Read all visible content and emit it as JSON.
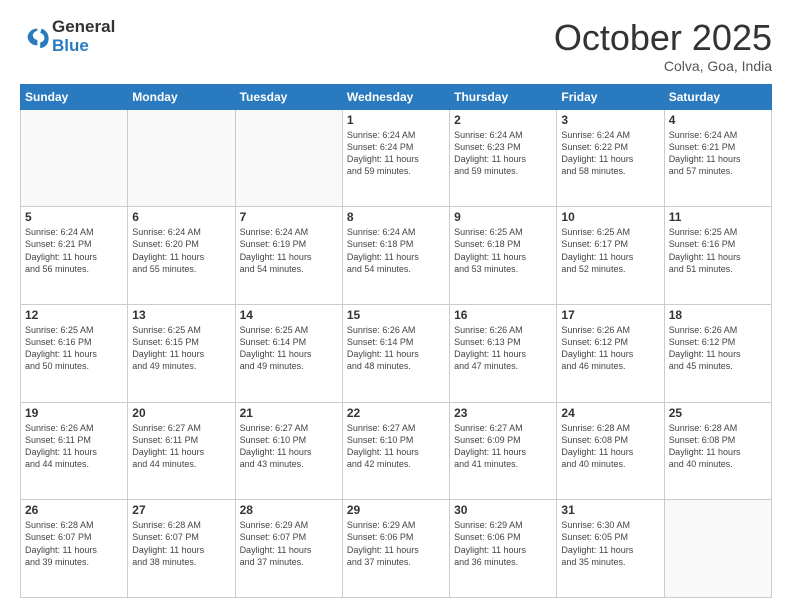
{
  "header": {
    "logo_general": "General",
    "logo_blue": "Blue",
    "month_title": "October 2025",
    "subtitle": "Colva, Goa, India"
  },
  "weekdays": [
    "Sunday",
    "Monday",
    "Tuesday",
    "Wednesday",
    "Thursday",
    "Friday",
    "Saturday"
  ],
  "weeks": [
    [
      {
        "day": "",
        "info": ""
      },
      {
        "day": "",
        "info": ""
      },
      {
        "day": "",
        "info": ""
      },
      {
        "day": "1",
        "info": "Sunrise: 6:24 AM\nSunset: 6:24 PM\nDaylight: 11 hours\nand 59 minutes."
      },
      {
        "day": "2",
        "info": "Sunrise: 6:24 AM\nSunset: 6:23 PM\nDaylight: 11 hours\nand 59 minutes."
      },
      {
        "day": "3",
        "info": "Sunrise: 6:24 AM\nSunset: 6:22 PM\nDaylight: 11 hours\nand 58 minutes."
      },
      {
        "day": "4",
        "info": "Sunrise: 6:24 AM\nSunset: 6:21 PM\nDaylight: 11 hours\nand 57 minutes."
      }
    ],
    [
      {
        "day": "5",
        "info": "Sunrise: 6:24 AM\nSunset: 6:21 PM\nDaylight: 11 hours\nand 56 minutes."
      },
      {
        "day": "6",
        "info": "Sunrise: 6:24 AM\nSunset: 6:20 PM\nDaylight: 11 hours\nand 55 minutes."
      },
      {
        "day": "7",
        "info": "Sunrise: 6:24 AM\nSunset: 6:19 PM\nDaylight: 11 hours\nand 54 minutes."
      },
      {
        "day": "8",
        "info": "Sunrise: 6:24 AM\nSunset: 6:18 PM\nDaylight: 11 hours\nand 54 minutes."
      },
      {
        "day": "9",
        "info": "Sunrise: 6:25 AM\nSunset: 6:18 PM\nDaylight: 11 hours\nand 53 minutes."
      },
      {
        "day": "10",
        "info": "Sunrise: 6:25 AM\nSunset: 6:17 PM\nDaylight: 11 hours\nand 52 minutes."
      },
      {
        "day": "11",
        "info": "Sunrise: 6:25 AM\nSunset: 6:16 PM\nDaylight: 11 hours\nand 51 minutes."
      }
    ],
    [
      {
        "day": "12",
        "info": "Sunrise: 6:25 AM\nSunset: 6:16 PM\nDaylight: 11 hours\nand 50 minutes."
      },
      {
        "day": "13",
        "info": "Sunrise: 6:25 AM\nSunset: 6:15 PM\nDaylight: 11 hours\nand 49 minutes."
      },
      {
        "day": "14",
        "info": "Sunrise: 6:25 AM\nSunset: 6:14 PM\nDaylight: 11 hours\nand 49 minutes."
      },
      {
        "day": "15",
        "info": "Sunrise: 6:26 AM\nSunset: 6:14 PM\nDaylight: 11 hours\nand 48 minutes."
      },
      {
        "day": "16",
        "info": "Sunrise: 6:26 AM\nSunset: 6:13 PM\nDaylight: 11 hours\nand 47 minutes."
      },
      {
        "day": "17",
        "info": "Sunrise: 6:26 AM\nSunset: 6:12 PM\nDaylight: 11 hours\nand 46 minutes."
      },
      {
        "day": "18",
        "info": "Sunrise: 6:26 AM\nSunset: 6:12 PM\nDaylight: 11 hours\nand 45 minutes."
      }
    ],
    [
      {
        "day": "19",
        "info": "Sunrise: 6:26 AM\nSunset: 6:11 PM\nDaylight: 11 hours\nand 44 minutes."
      },
      {
        "day": "20",
        "info": "Sunrise: 6:27 AM\nSunset: 6:11 PM\nDaylight: 11 hours\nand 44 minutes."
      },
      {
        "day": "21",
        "info": "Sunrise: 6:27 AM\nSunset: 6:10 PM\nDaylight: 11 hours\nand 43 minutes."
      },
      {
        "day": "22",
        "info": "Sunrise: 6:27 AM\nSunset: 6:10 PM\nDaylight: 11 hours\nand 42 minutes."
      },
      {
        "day": "23",
        "info": "Sunrise: 6:27 AM\nSunset: 6:09 PM\nDaylight: 11 hours\nand 41 minutes."
      },
      {
        "day": "24",
        "info": "Sunrise: 6:28 AM\nSunset: 6:08 PM\nDaylight: 11 hours\nand 40 minutes."
      },
      {
        "day": "25",
        "info": "Sunrise: 6:28 AM\nSunset: 6:08 PM\nDaylight: 11 hours\nand 40 minutes."
      }
    ],
    [
      {
        "day": "26",
        "info": "Sunrise: 6:28 AM\nSunset: 6:07 PM\nDaylight: 11 hours\nand 39 minutes."
      },
      {
        "day": "27",
        "info": "Sunrise: 6:28 AM\nSunset: 6:07 PM\nDaylight: 11 hours\nand 38 minutes."
      },
      {
        "day": "28",
        "info": "Sunrise: 6:29 AM\nSunset: 6:07 PM\nDaylight: 11 hours\nand 37 minutes."
      },
      {
        "day": "29",
        "info": "Sunrise: 6:29 AM\nSunset: 6:06 PM\nDaylight: 11 hours\nand 37 minutes."
      },
      {
        "day": "30",
        "info": "Sunrise: 6:29 AM\nSunset: 6:06 PM\nDaylight: 11 hours\nand 36 minutes."
      },
      {
        "day": "31",
        "info": "Sunrise: 6:30 AM\nSunset: 6:05 PM\nDaylight: 11 hours\nand 35 minutes."
      },
      {
        "day": "",
        "info": ""
      }
    ]
  ]
}
